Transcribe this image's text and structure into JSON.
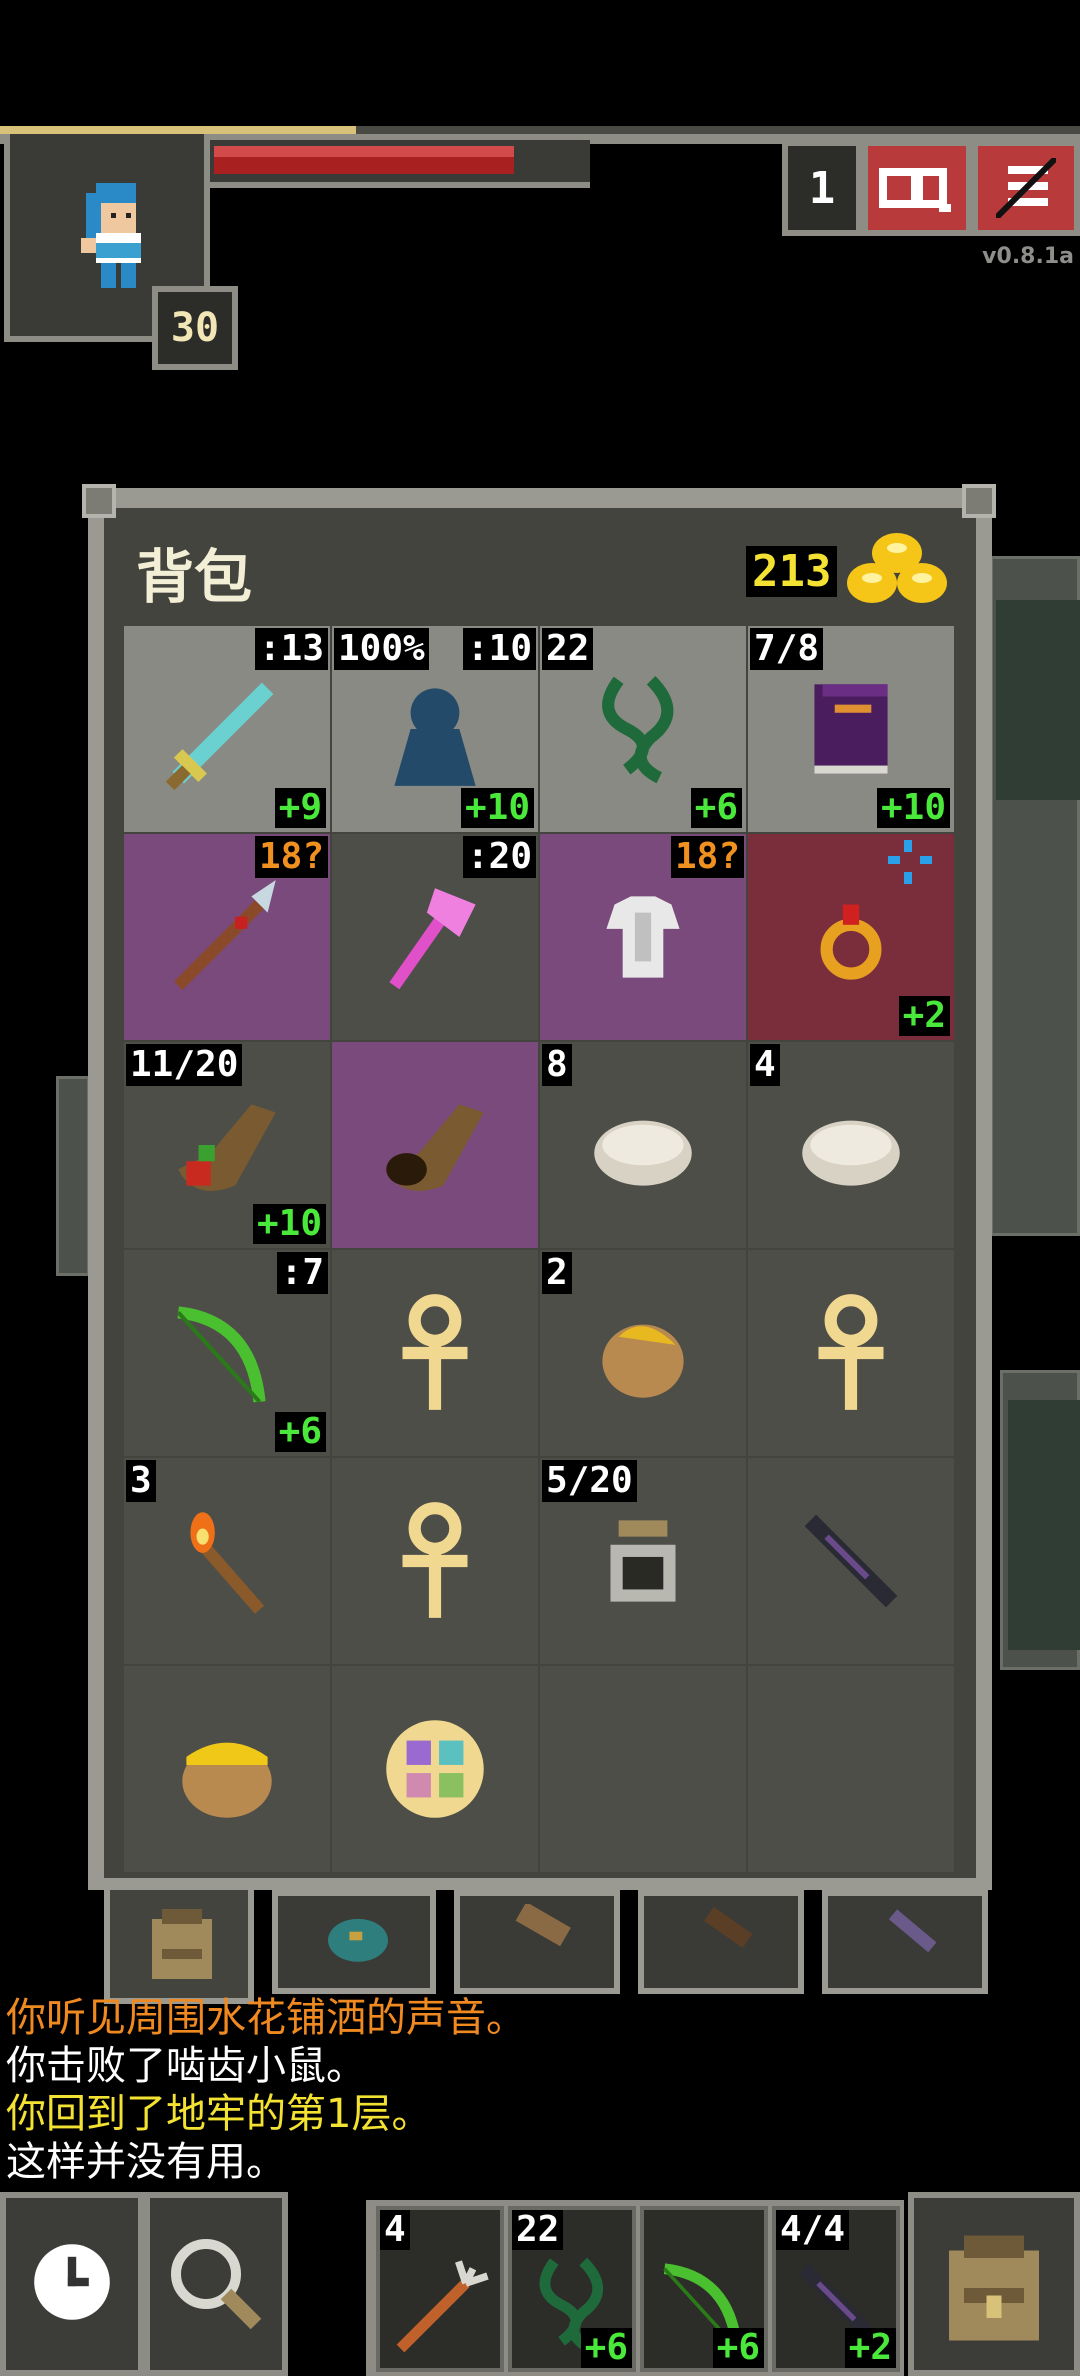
{
  "hud": {
    "hero_level": "30",
    "depth": "1",
    "version": "v0.8.1a",
    "hp_fraction": 0.82,
    "xp_fraction": 0.33
  },
  "backpack": {
    "title": "背包",
    "gold": "213",
    "slots": [
      {
        "icon": "sword-icon",
        "bg": "light",
        "tl": "",
        "tr": ":13",
        "br": "+9"
      },
      {
        "icon": "cloak-icon",
        "bg": "light",
        "tl": "100%",
        "tr": ":10",
        "br": "+10"
      },
      {
        "icon": "chain-whip-icon",
        "bg": "light",
        "tl": "22",
        "tr": "",
        "br": "+6"
      },
      {
        "icon": "spellbook-icon",
        "bg": "light",
        "tl": "7/8",
        "tr": "",
        "br": "+10"
      },
      {
        "icon": "spear-icon",
        "bg": "purple",
        "tl": "",
        "tr": "18?",
        "br": ""
      },
      {
        "icon": "pink-axe-icon",
        "bg": "dark",
        "tl": "",
        "tr": ":20",
        "br": ""
      },
      {
        "icon": "armor-icon",
        "bg": "purple",
        "tl": "",
        "tr": "18?",
        "br": ""
      },
      {
        "icon": "ring-icon",
        "bg": "red",
        "tl": "",
        "tr": "",
        "br": "+2"
      },
      {
        "icon": "horn-of-plenty-icon",
        "bg": "dark",
        "tl": "11/20",
        "tr": "",
        "br": "+10"
      },
      {
        "icon": "empty-horn-icon",
        "bg": "purple",
        "tl": "",
        "tr": "",
        "br": ""
      },
      {
        "icon": "stone-icon",
        "bg": "dark",
        "tl": "8",
        "tr": "",
        "br": ""
      },
      {
        "icon": "stone-icon",
        "bg": "dark",
        "tl": "4",
        "tr": "",
        "br": ""
      },
      {
        "icon": "bow-icon",
        "bg": "dark",
        "tl": "",
        "tr": ":7",
        "br": "+6"
      },
      {
        "icon": "ankh-icon",
        "bg": "dark",
        "tl": "",
        "tr": "",
        "br": ""
      },
      {
        "icon": "honey-seed-icon",
        "bg": "dark",
        "tl": "2",
        "tr": "",
        "br": ""
      },
      {
        "icon": "ankh-icon",
        "bg": "dark",
        "tl": "",
        "tr": "",
        "br": ""
      },
      {
        "icon": "torch-icon",
        "bg": "dark",
        "tl": "3",
        "tr": "",
        "br": ""
      },
      {
        "icon": "ankh-icon",
        "bg": "dark",
        "tl": "",
        "tr": "",
        "br": ""
      },
      {
        "icon": "dew-vial-icon",
        "bg": "dark",
        "tl": "5/20",
        "tr": "",
        "br": ""
      },
      {
        "icon": "dark-wand-icon",
        "bg": "dark",
        "tl": "",
        "tr": "",
        "br": ""
      },
      {
        "icon": "honey-pot-icon",
        "bg": "dark",
        "tl": "",
        "tr": "",
        "br": ""
      },
      {
        "icon": "rune-disc-icon",
        "bg": "dark",
        "tl": "",
        "tr": "",
        "br": ""
      },
      {
        "icon": "",
        "bg": "dark",
        "tl": "",
        "tr": "",
        "br": ""
      },
      {
        "icon": "",
        "bg": "dark",
        "tl": "",
        "tr": "",
        "br": ""
      }
    ]
  },
  "log": {
    "lines": [
      {
        "text": "你听见周围水花铺洒的声音。",
        "color": "#f08a20"
      },
      {
        "text": "你击败了啮齿小鼠。",
        "color": "#ffffff"
      },
      {
        "text": "你回到了地牢的第1层。",
        "color": "#f3e232"
      },
      {
        "text": "这样并没有用。",
        "color": "#ffffff"
      }
    ]
  },
  "quickslots": [
    {
      "icon": "trident-icon",
      "tl": "4",
      "br": ""
    },
    {
      "icon": "chain-whip-icon",
      "tl": "22",
      "br": "+6"
    },
    {
      "icon": "bow-icon",
      "tl": "",
      "br": "+6"
    },
    {
      "icon": "dark-wand-icon",
      "tl": "4/4",
      "br": "+2"
    }
  ]
}
